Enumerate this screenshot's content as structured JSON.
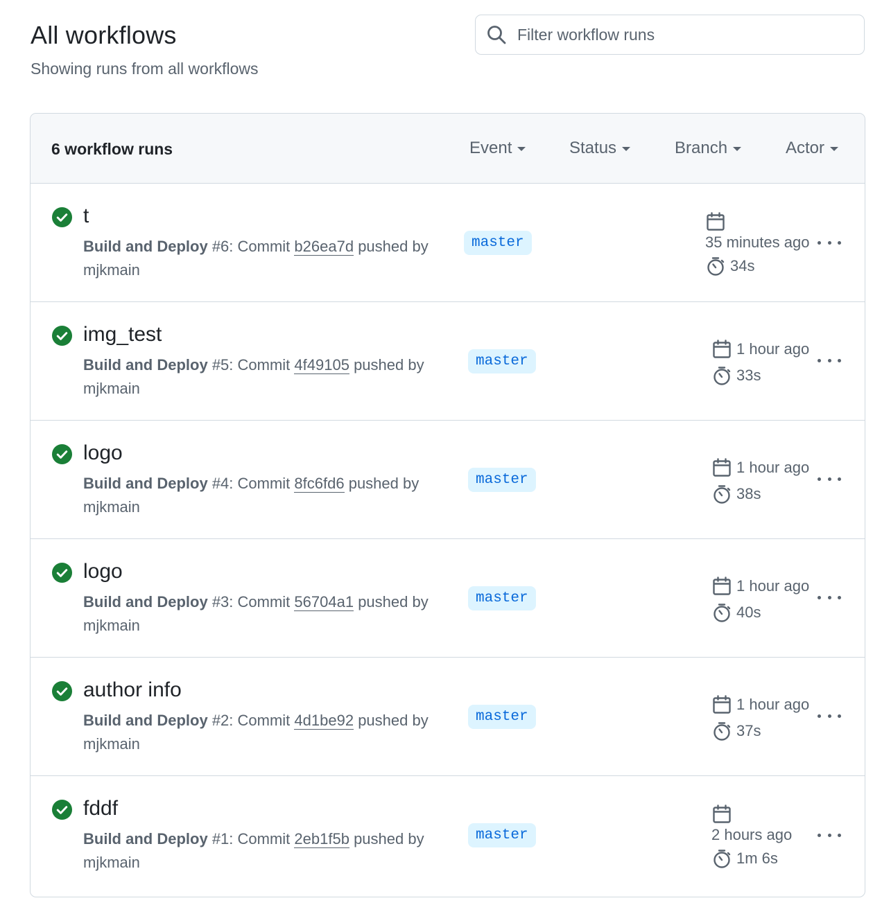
{
  "header": {
    "title": "All workflows",
    "subtitle": "Showing runs from all workflows"
  },
  "search": {
    "placeholder": "Filter workflow runs"
  },
  "list": {
    "count_label": "6 workflow runs",
    "filters": [
      "Event",
      "Status",
      "Branch",
      "Actor"
    ]
  },
  "runs": [
    {
      "title": "t",
      "workflow": "Build and Deploy",
      "number": "#6",
      "commit_prefix": ": Commit ",
      "sha": "b26ea7d",
      "pushed_by": " pushed by",
      "actor": "mjkmain",
      "branch": "master",
      "time": "35 minutes ago",
      "duration": "34s",
      "status": "success"
    },
    {
      "title": "img_test",
      "workflow": "Build and Deploy",
      "number": "#5",
      "commit_prefix": ": Commit ",
      "sha": "4f49105",
      "pushed_by": " pushed by",
      "actor": "mjkmain",
      "branch": "master",
      "time": "1 hour ago",
      "duration": "33s",
      "status": "success"
    },
    {
      "title": "logo",
      "workflow": "Build and Deploy",
      "number": "#4",
      "commit_prefix": ": Commit ",
      "sha": "8fc6fd6",
      "pushed_by": " pushed by",
      "actor": "mjkmain",
      "branch": "master",
      "time": "1 hour ago",
      "duration": "38s",
      "status": "success"
    },
    {
      "title": "logo",
      "workflow": "Build and Deploy",
      "number": "#3",
      "commit_prefix": ": Commit ",
      "sha": "56704a1",
      "pushed_by": " pushed by",
      "actor": "mjkmain",
      "branch": "master",
      "time": "1 hour ago",
      "duration": "40s",
      "status": "success"
    },
    {
      "title": "author info",
      "workflow": "Build and Deploy",
      "number": "#2",
      "commit_prefix": ": Commit ",
      "sha": "4d1be92",
      "pushed_by": " pushed by",
      "actor": "mjkmain",
      "branch": "master",
      "time": "1 hour ago",
      "duration": "37s",
      "status": "success"
    },
    {
      "title": "fddf",
      "workflow": "Build and Deploy",
      "number": "#1",
      "commit_prefix": ": Commit ",
      "sha": "2eb1f5b",
      "pushed_by": " pushed by",
      "actor": "mjkmain",
      "branch": "master",
      "time": "2 hours ago",
      "duration": "1m 6s",
      "status": "success"
    }
  ],
  "colors": {
    "success": "#1a7f37",
    "branch_bg": "#ddf4ff",
    "branch_fg": "#0969da",
    "muted": "#59636e"
  },
  "icons": {
    "search": "search-icon",
    "status": "check-circle-fill-icon",
    "calendar": "calendar-icon",
    "duration": "stopwatch-icon",
    "menu": "kebab-horizontal-icon"
  }
}
